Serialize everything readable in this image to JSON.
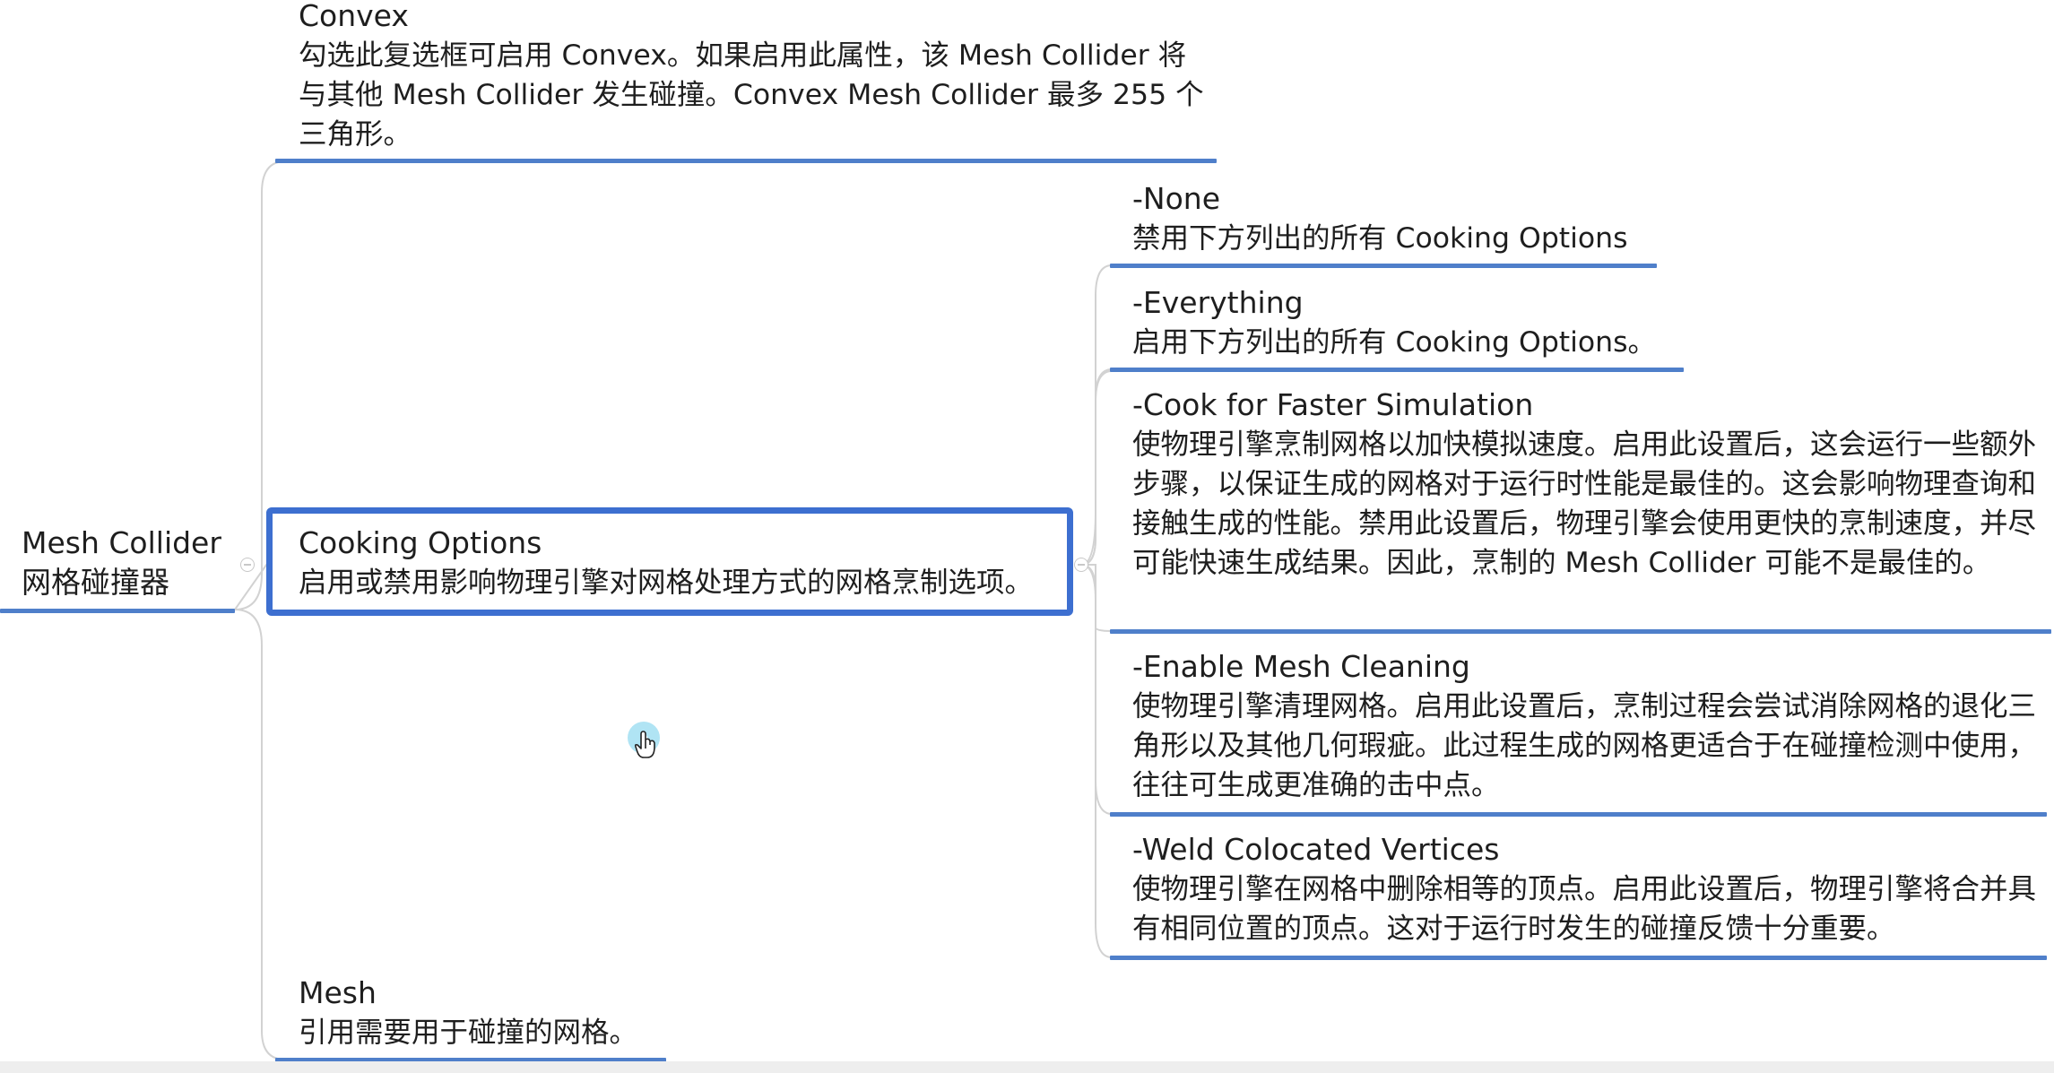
{
  "root": {
    "title": "Mesh Collider",
    "subtitle": "网格碰撞器"
  },
  "convex": {
    "title": "Convex",
    "desc": "勾选此复选框可启用 Convex。如果启用此属性，该 Mesh Collider 将与其他 Mesh Collider 发生碰撞。Convex Mesh Collider 最多 255 个三角形。"
  },
  "cooking": {
    "title": "Cooking Options",
    "desc": "启用或禁用影响物理引擎对网格处理方式的网格烹制选项。"
  },
  "mesh": {
    "title": "Mesh",
    "desc": "引用需要用于碰撞的网格。"
  },
  "options": [
    {
      "title": "-None",
      "desc": "禁用下方列出的所有 Cooking Options"
    },
    {
      "title": "-Everything",
      "desc": "启用下方列出的所有 Cooking Options。"
    },
    {
      "title": "-Cook for Faster Simulation",
      "desc": "使物理引擎烹制网格以加快模拟速度。启用此设置后，这会运行一些额外步骤，以保证生成的网格对于运行时性能是最佳的。这会影响物理查询和接触生成的性能。禁用此设置后，物理引擎会使用更快的烹制速度，并尽可能快速生成结果。因此，烹制的 Mesh Collider 可能不是最佳的。"
    },
    {
      "title": "-Enable Mesh Cleaning",
      "desc": "使物理引擎清理网格。启用此设置后，烹制过程会尝试消除网格的退化三角形以及其他几何瑕疵。此过程生成的网格更适合于在碰撞检测中使用，往往可生成更准确的击中点。"
    },
    {
      "title": "-Weld Colocated Vertices",
      "desc": "使物理引擎在网格中删除相等的顶点。启用此设置后，物理引擎将合并具有相同位置的顶点。这对于运行时发生的碰撞反馈十分重要。"
    }
  ],
  "colors": {
    "accent": "#4f7fca",
    "selection": "#3d6fd0",
    "connector": "#d0d0d0",
    "text": "#1e1e1e"
  },
  "icons": {
    "collapse": "minus-circle-icon",
    "cursor": "hand-pointer-icon"
  }
}
